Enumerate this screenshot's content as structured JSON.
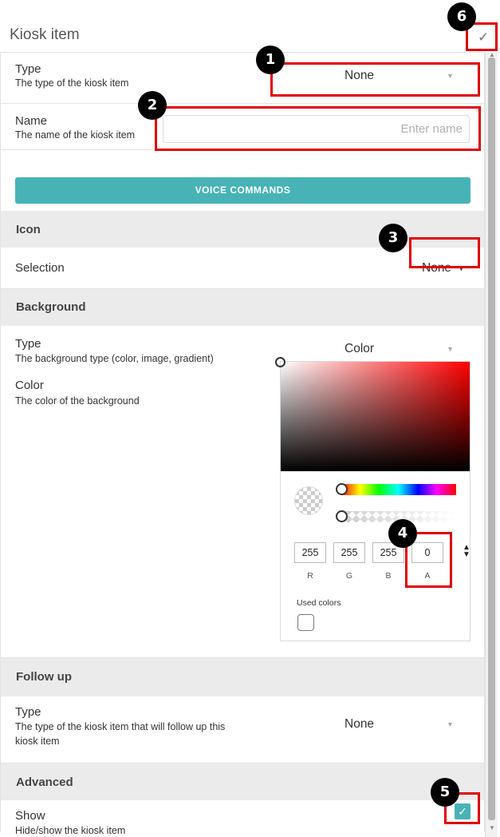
{
  "header": {
    "title": "Kiosk item",
    "confirm_icon": "checkmark-icon",
    "confirm_glyph": "✓"
  },
  "type_row": {
    "label": "Type",
    "description": "The type of the kiosk item",
    "value": "None"
  },
  "name_row": {
    "label": "Name",
    "description": "The name of the kiosk item",
    "placeholder": "Enter name",
    "value": ""
  },
  "voice_button": {
    "label": "VOICE COMMANDS"
  },
  "icon_section": {
    "title": "Icon",
    "selection_label": "Selection",
    "selection_value": "None"
  },
  "background_section": {
    "title": "Background",
    "type_label": "Type",
    "type_description": "The background type (color, image, gradient)",
    "type_value": "Color",
    "color_label": "Color",
    "color_description": "The color of the background",
    "picker": {
      "r": "255",
      "g": "255",
      "b": "255",
      "a": "0",
      "r_label": "R",
      "g_label": "G",
      "b_label": "B",
      "a_label": "A",
      "used_colors_label": "Used colors"
    }
  },
  "follow_up_section": {
    "title": "Follow up",
    "type_label": "Type",
    "type_description_line1": "The type of the kiosk item that will follow up this",
    "type_description_line2": "kiosk item",
    "type_value": "None"
  },
  "advanced_section": {
    "title": "Advanced",
    "show_label": "Show",
    "show_description": "Hide/show the kiosk item",
    "show_checked": true
  },
  "annotations": [
    "1",
    "2",
    "3",
    "4",
    "5",
    "6"
  ],
  "colors": {
    "accent": "#47b3b6",
    "highlight": "#e00000",
    "section_bg": "#ebebeb"
  }
}
